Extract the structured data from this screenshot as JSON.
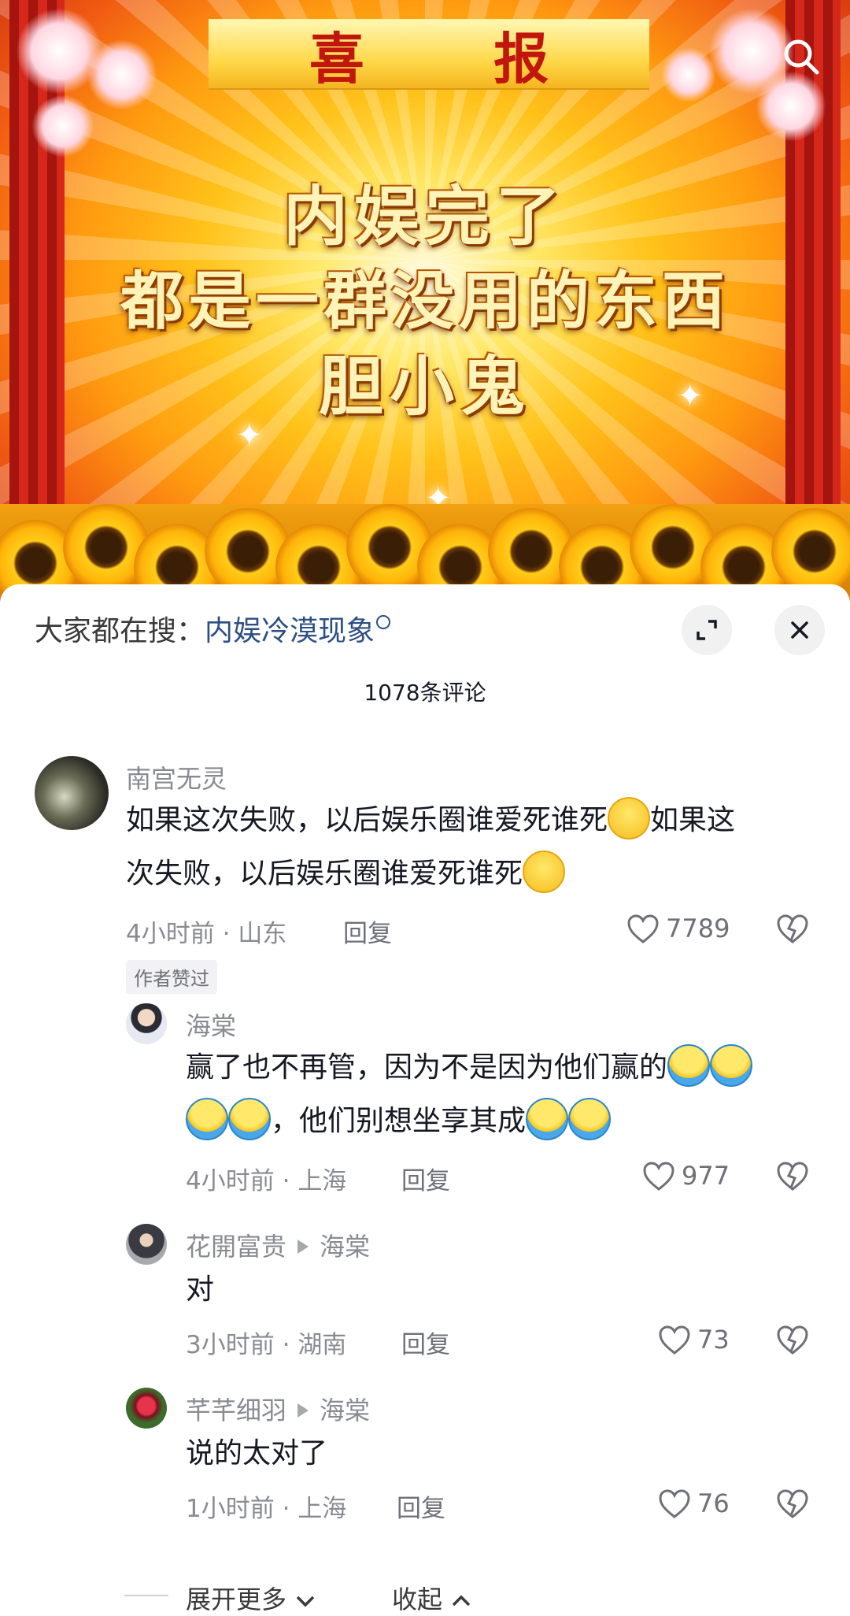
{
  "banner": {
    "title": "喜 报",
    "lines": [
      "内娱完了",
      "都是一群没用的东西",
      "胆小鬼"
    ]
  },
  "search_bar": {
    "prefix": "大家都在搜：",
    "hot_term": "内娱冷漠现象"
  },
  "comment_count": "1078条评论",
  "comments": [
    {
      "user": "南宫无灵",
      "text_1": "如果这次失败，以后娱乐圈谁爱死谁死",
      "text_2": "如果这",
      "text_3": "次失败，以后娱乐圈谁爱死谁死",
      "time": "4小时前",
      "location": "山东",
      "reply": "回复",
      "likes": "7789",
      "badge": "作者赞过"
    },
    {
      "user": "海棠",
      "text_1": "赢了也不再管，因为不是因为他们赢的",
      "text_2": "，他们别想坐享其成",
      "time": "4小时前",
      "location": "上海",
      "reply": "回复",
      "likes": "977"
    },
    {
      "user": "花開富贵",
      "reply_to": "海棠",
      "text_1": "对",
      "time": "3小时前",
      "location": "湖南",
      "reply": "回复",
      "likes": "73"
    },
    {
      "user": "芊芊细羽",
      "reply_to": "海棠",
      "text_1": "说的太对了",
      "time": "1小时前",
      "location": "上海",
      "reply": "回复",
      "likes": "76"
    }
  ],
  "footer": {
    "expand": "展开更多",
    "collapse": "收起"
  },
  "meta_sep": "·",
  "icons": [
    "search-icon",
    "expand-icon",
    "close-icon",
    "heart-icon",
    "dislike-icon",
    "chevron-down-icon",
    "chevron-up-icon"
  ]
}
